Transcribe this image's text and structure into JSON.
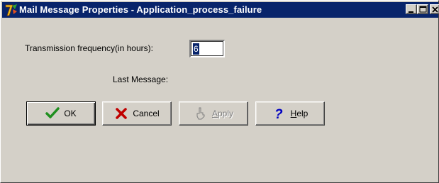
{
  "window": {
    "title": "Mail Message Properties  - Application_process_failure",
    "title_icon": "app-7-icon",
    "caption_buttons": [
      "minimize",
      "maximize",
      "close"
    ]
  },
  "form": {
    "frequency_label": "Transmission frequency(in hours):",
    "frequency_value": "6",
    "last_message_label": "Last Message:"
  },
  "buttons": {
    "ok": {
      "label": "OK",
      "icon": "checkmark-icon",
      "enabled": true
    },
    "cancel": {
      "label": "Cancel",
      "icon": "red-x-icon",
      "enabled": true
    },
    "apply": {
      "label_pre": "",
      "label_accel": "A",
      "label_post": "pply",
      "icon": "hand-pointer-icon",
      "enabled": false
    },
    "help": {
      "label_pre": "",
      "label_accel": "H",
      "label_post": "elp",
      "icon": "question-mark-icon",
      "enabled": true
    }
  },
  "colors": {
    "titlebar": "#08246b",
    "face": "#d4d0c8",
    "check_green": "#1f8f1f",
    "cancel_red": "#c00000",
    "help_blue": "#0000c0"
  }
}
